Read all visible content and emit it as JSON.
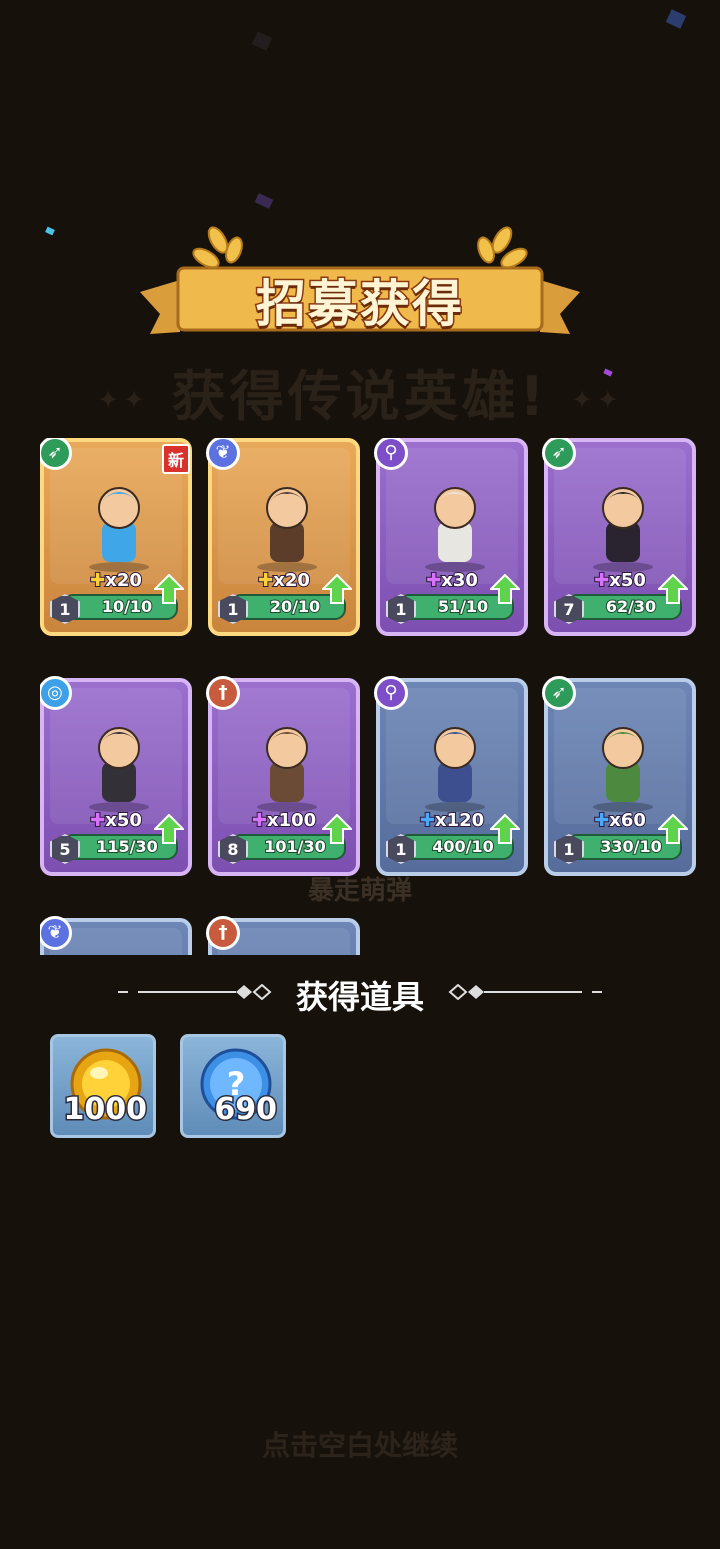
{
  "banner": {
    "title": "招募获得"
  },
  "subtitle": "获得传说英雄!",
  "heroes": [
    {
      "class_icon": "bow-icon",
      "rarity": "gold",
      "new_badge": "新",
      "shards": "x20",
      "level": "1",
      "progress": "10/10"
    },
    {
      "class_icon": "paw-icon",
      "rarity": "gold",
      "new_badge": "",
      "shards": "x20",
      "level": "1",
      "progress": "20/10"
    },
    {
      "class_icon": "staff-icon",
      "rarity": "purple",
      "new_badge": "",
      "shards": "x30",
      "level": "1",
      "progress": "51/10"
    },
    {
      "class_icon": "bow-icon",
      "rarity": "purple",
      "new_badge": "",
      "shards": "x50",
      "level": "7",
      "progress": "62/30"
    },
    {
      "class_icon": "swirl-icon",
      "rarity": "purple",
      "new_badge": "",
      "shards": "x50",
      "level": "5",
      "progress": "115/30"
    },
    {
      "class_icon": "sword-icon",
      "rarity": "purple",
      "new_badge": "",
      "shards": "x100",
      "level": "8",
      "progress": "101/30"
    },
    {
      "class_icon": "staff-icon",
      "rarity": "blue",
      "new_badge": "",
      "shards": "x120",
      "level": "1",
      "progress": "400/10"
    },
    {
      "class_icon": "bow-icon",
      "rarity": "blue",
      "new_badge": "",
      "shards": "x60",
      "level": "1",
      "progress": "330/10"
    },
    {
      "class_icon": "paw-icon",
      "rarity": "blue",
      "new_badge": "",
      "shards": "",
      "level": "",
      "progress": ""
    },
    {
      "class_icon": "sword-icon",
      "rarity": "blue",
      "new_badge": "",
      "shards": "",
      "level": "",
      "progress": ""
    }
  ],
  "background_label": "暴走萌弹",
  "items_section": {
    "title": "获得道具"
  },
  "items": [
    {
      "icon": "gold-coin-icon",
      "count": "1000"
    },
    {
      "icon": "mystery-orb-icon",
      "count": "690"
    }
  ],
  "continue_hint": "点击空白处继续"
}
